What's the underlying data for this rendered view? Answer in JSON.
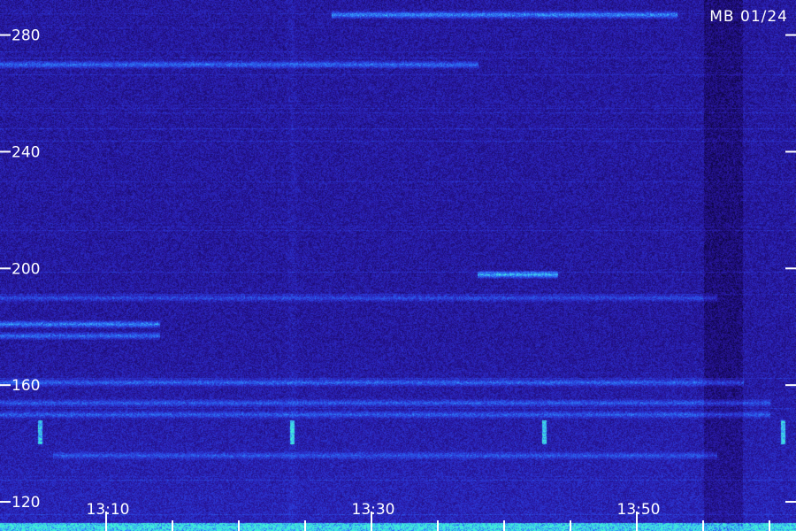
{
  "chart_data": {
    "type": "heatmap",
    "title": "",
    "xlabel": "",
    "ylabel": "",
    "station_label": "MB 01/24",
    "colormap": [
      "#000010",
      "#1a0a6a",
      "#2a1aa8",
      "#2a3ad8",
      "#2a6af0",
      "#3aa0ff",
      "#40f0d8"
    ],
    "background_color": "#100830",
    "noise_color": "#2a1fa0",
    "tick_color": "#ffffff",
    "label_color": "#ffffff",
    "grid": false,
    "y": {
      "range": [
        110,
        292
      ],
      "ticks": [
        120,
        160,
        200,
        240,
        280
      ],
      "tick_labels": [
        "120",
        "160",
        "200",
        "240",
        "280"
      ]
    },
    "x": {
      "range": [
        "13:02",
        "13:62"
      ],
      "major_ticks": [
        "13:10",
        "13:30",
        "13:50"
      ],
      "minor_ticks": [
        "13:15",
        "13:20",
        "13:25",
        "13:35",
        "13:40",
        "13:45",
        "13:55",
        "13:60"
      ],
      "tick_labels": [
        "13:10",
        "13:30",
        "13:50"
      ]
    },
    "features": {
      "horizontal_bands": [
        {
          "freq": 287,
          "intensity": 0.55,
          "from": "13:27",
          "to": "13:53"
        },
        {
          "freq": 270,
          "intensity": 0.45,
          "from": "13:02",
          "to": "13:38"
        },
        {
          "freq": 198,
          "intensity": 0.7,
          "from": "13:38",
          "to": "13:44"
        },
        {
          "freq": 190,
          "intensity": 0.3,
          "from": "13:02",
          "to": "13:56"
        },
        {
          "freq": 181,
          "intensity": 0.55,
          "from": "13:02",
          "to": "13:14"
        },
        {
          "freq": 177,
          "intensity": 0.45,
          "from": "13:02",
          "to": "13:14"
        },
        {
          "freq": 161,
          "intensity": 0.4,
          "from": "13:02",
          "to": "13:58"
        },
        {
          "freq": 154,
          "intensity": 0.35,
          "from": "13:02",
          "to": "13:60"
        },
        {
          "freq": 150,
          "intensity": 0.35,
          "from": "13:02",
          "to": "13:60"
        },
        {
          "freq": 136,
          "intensity": 0.3,
          "from": "13:06",
          "to": "13:56"
        }
      ],
      "vertical_bursts": [
        "13:05",
        "13:24",
        "13:43",
        "13:61"
      ],
      "burst_freq": [
        140,
        148
      ],
      "faint_verticals": [
        "13:24"
      ],
      "low_band": {
        "freq_min": 110,
        "freq_max": 113,
        "intensity": 0.8
      },
      "dark_region": {
        "from": "13:55",
        "to": "13:58"
      }
    }
  }
}
